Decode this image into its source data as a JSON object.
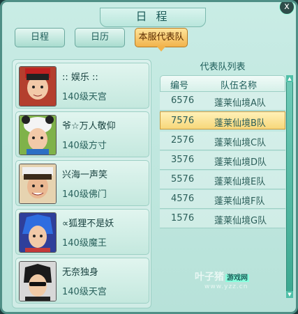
{
  "window": {
    "title": "日 程",
    "close_glyph": "x"
  },
  "tabs": [
    {
      "label": "日程"
    },
    {
      "label": "日历"
    },
    {
      "label": "本服代表队",
      "active": true
    }
  ],
  "members": [
    {
      "name": ":: 娱乐 ::",
      "level": "140级天宫"
    },
    {
      "name": "爷☆万人敬仰",
      "level": "140级方寸"
    },
    {
      "name": "兴海一声笑",
      "level": "140级佛门"
    },
    {
      "name": "∝狐狸不是妖",
      "level": "140级魔王"
    },
    {
      "name": "无奈独身",
      "level": "140级天宫"
    }
  ],
  "team_list": {
    "title": "代表队列表",
    "columns": [
      "编号",
      "队伍名称"
    ],
    "rows": [
      {
        "id": "6576",
        "name": "蓬莱仙境A队"
      },
      {
        "id": "7576",
        "name": "蓬莱仙境B队",
        "selected": true
      },
      {
        "id": "2576",
        "name": "蓬莱仙境C队"
      },
      {
        "id": "3576",
        "name": "蓬莱仙境D队"
      },
      {
        "id": "5576",
        "name": "蓬莱仙境E队"
      },
      {
        "id": "4576",
        "name": "蓬莱仙境F队"
      },
      {
        "id": "1576",
        "name": "蓬莱仙境G队"
      }
    ]
  },
  "watermark": {
    "brand": "叶子猪",
    "tag": "游戏网",
    "url": "www.yzz.cn"
  },
  "colors": {
    "accent": "#f1b34c",
    "panel": "#c9ece5",
    "selected_row": "#f7d77a"
  }
}
